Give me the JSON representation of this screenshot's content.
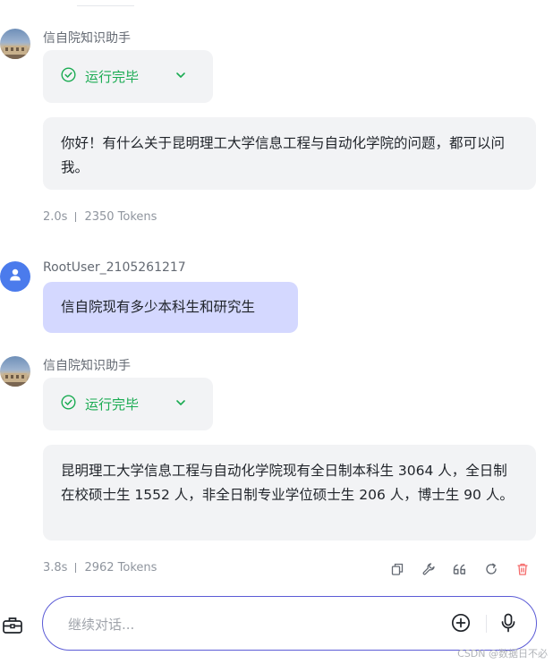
{
  "conversation": {
    "messages": [
      {
        "sender": "信自院知识助手",
        "status": "运行完毕",
        "content": "你好！有什么关于昆明理工大学信息工程与自动化学院的问题，都可以问我。",
        "time": "2.0s",
        "tokens": "2350 Tokens"
      },
      {
        "sender": "RootUser_2105261217",
        "content": "信自院现有多少本科生和研究生"
      },
      {
        "sender": "信自院知识助手",
        "status": "运行完毕",
        "content": "昆明理工大学信息工程与自动化学院现有全日制本科生 3064 人，全日制在校硕士生 1552 人，非全日制专业学位硕士生 206 人，博士生 90 人。",
        "time": "3.8s",
        "tokens": "2962 Tokens"
      }
    ]
  },
  "input": {
    "placeholder": "继续对话..."
  },
  "watermark": "CSDN @数据日不必",
  "colors": {
    "accent": "#5b5bd6",
    "success": "#1aab52",
    "user_bubble": "#d4d8ff",
    "bot_bubble": "#f2f3f5",
    "delete": "#f56c6c"
  },
  "icons": [
    "check-circle-icon",
    "chevron-down-icon",
    "user-icon",
    "copy-icon",
    "wrench-icon",
    "quote-icon",
    "refresh-icon",
    "trash-icon",
    "toolbox-icon",
    "add-circle-icon",
    "microphone-icon"
  ]
}
